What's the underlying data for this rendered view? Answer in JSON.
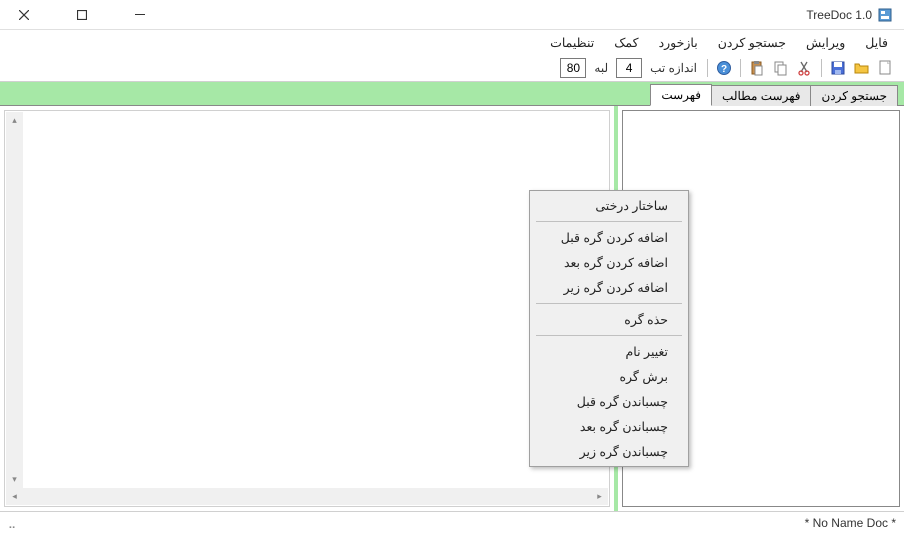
{
  "titlebar": {
    "app_name": "TreeDoc 1.0"
  },
  "menubar": {
    "file": "فایل",
    "edit": "ویرایش",
    "search": "جستجو کردن",
    "feedback": "بازخورد",
    "help": "کمک",
    "settings": "تنظیمات"
  },
  "toolbar": {
    "tab_size_label": "اندازه تب",
    "tab_size_value": "4",
    "page_label": "لبه",
    "page_value": "80"
  },
  "tabs": {
    "t1": "جستجو کردن",
    "t2": "فهرست مطالب",
    "t3": "فهرست"
  },
  "context_menu": {
    "tree_structure": "ساختار درختی",
    "add_before": "اضافه کردن گره قبل",
    "add_after": "اضافه کردن گره بعد",
    "add_child": "اضافه کردن گره زیر",
    "delete": "حذه گره",
    "rename": "تغییر نام",
    "cut": "برش گره",
    "paste_before": "چسباندن گره قبل",
    "paste_after": "چسباندن گره بعد",
    "paste_child": "چسباندن گره زیر"
  },
  "statusbar": {
    "doc_name": "* No Name Doc *"
  }
}
